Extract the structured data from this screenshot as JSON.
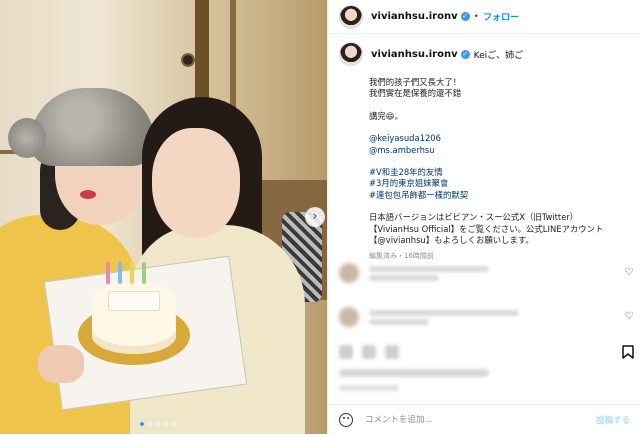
{
  "post": {
    "username": "vivianhsu.ironv",
    "follow_label": "フォロー",
    "separator": "•",
    "caption_head": "Keiご、姉ご",
    "lines": [
      "我們的孩子們又長大了！",
      "我們實在是保養的還不錯",
      "",
      "講完😄。",
      "",
      "@keiyasuda1206",
      "@ms.amberhsu",
      "",
      "#V和圭28年的友情",
      "#3月的東京姐妹聚會",
      "#連包包吊飾都一樣的默契",
      "",
      "日本語バージョンはビビアン・スー公式X（旧Twitter）",
      "【VivianHsu Official】をご覧ください。公式LINEアカウント",
      "【@vivianhsu】もよろしくお願いします。"
    ],
    "meta": "編集済み・16時間前",
    "icons": {
      "verified": "verified-badge-icon",
      "bookmark": "bookmark-icon",
      "heart": "heart-icon",
      "emoji": "emoji-icon",
      "arrow": "chevron-right-icon"
    }
  },
  "comment_box": {
    "placeholder": "コメントを追加...",
    "post_label": "投稿する"
  },
  "carousel": {
    "arrow": "›",
    "slide_count": 5,
    "active_index": 0
  },
  "colors": {
    "accent": "#0095f6",
    "verified": "#3897f0",
    "link": "#00376b"
  }
}
